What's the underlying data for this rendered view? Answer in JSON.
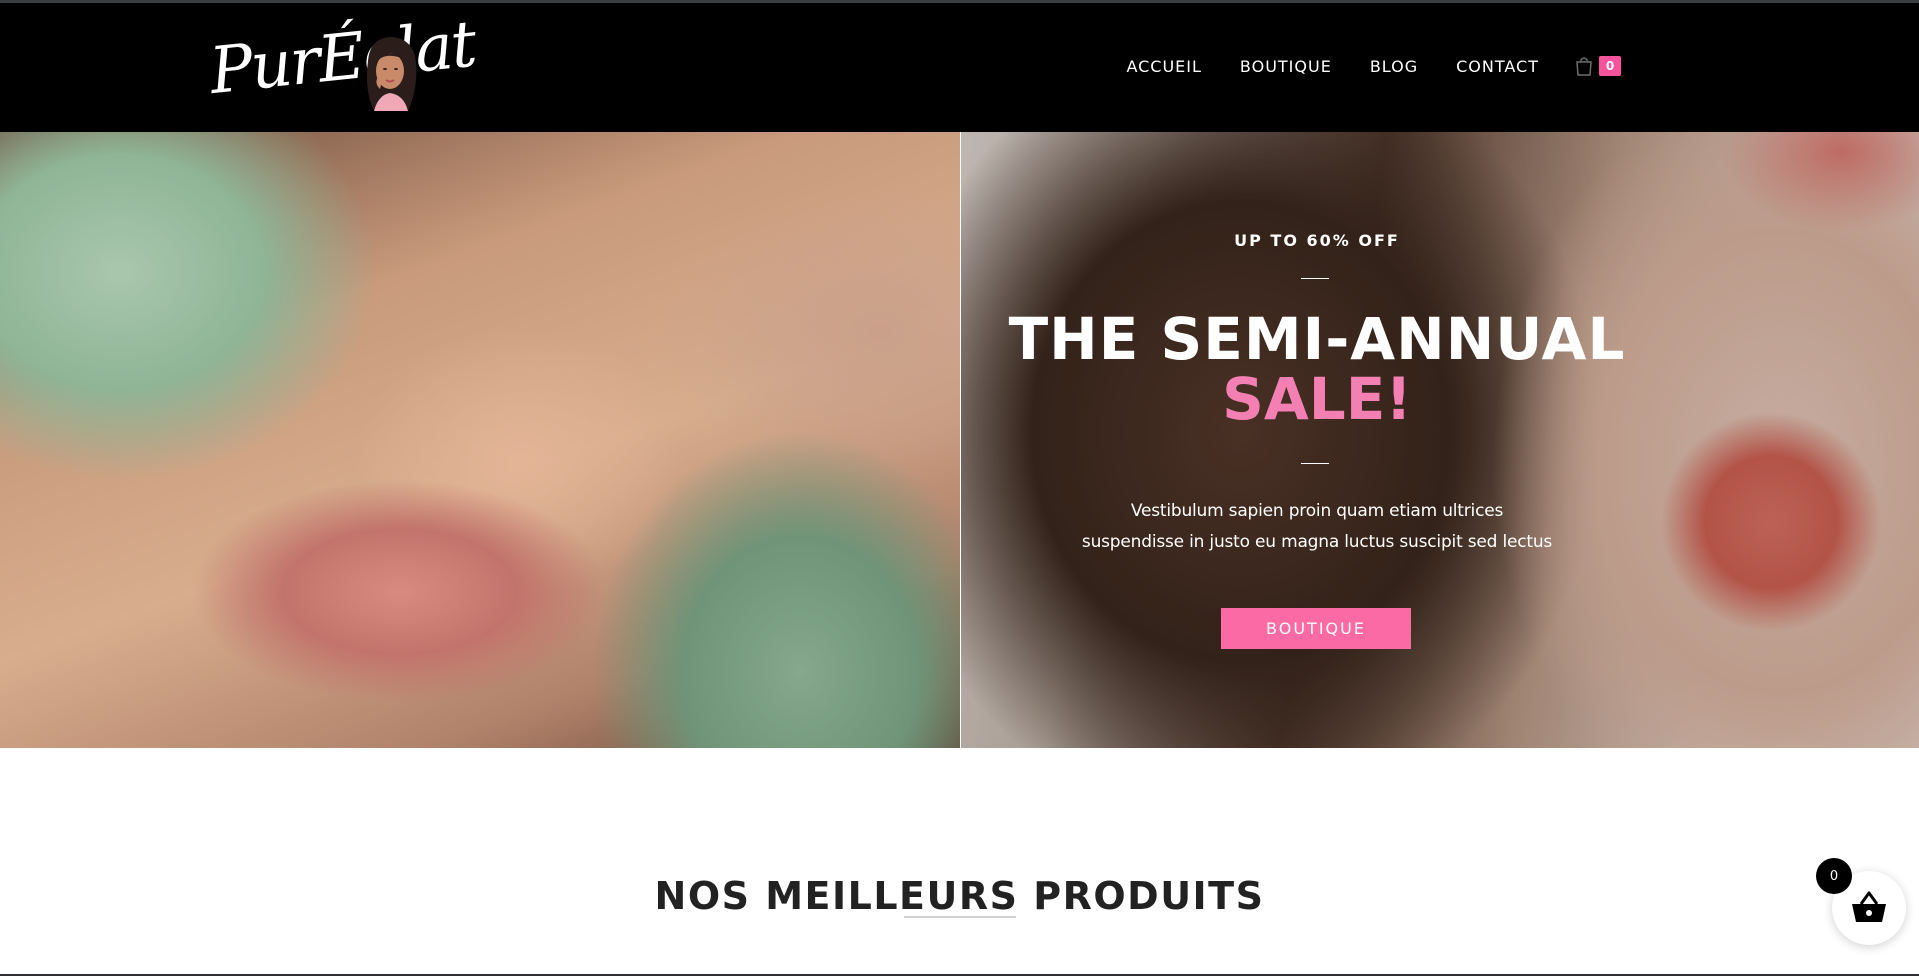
{
  "brand": {
    "logo_text": "PurÉclat"
  },
  "nav": {
    "items": [
      {
        "label": "ACCUEIL"
      },
      {
        "label": "BOUTIQUE"
      },
      {
        "label": "BLOG"
      },
      {
        "label": "CONTACT"
      }
    ],
    "cart_count": "0"
  },
  "hero": {
    "eyebrow": "UP TO 60% OFF",
    "title_line1": "THE SEMI-ANNUAL",
    "title_line2": "SALE!",
    "description_line1": "Vestibulum sapien proin quam etiam ultrices",
    "description_line2": "suspendisse in justo eu magna luctus suscipit sed lectus",
    "button_label": "BOUTIQUE"
  },
  "section": {
    "title": "NOS MEILLEURS PRODUITS"
  },
  "floating_cart": {
    "count": "0"
  },
  "colors": {
    "header_bg": "#000000",
    "accent_pink": "#fb6aa5",
    "title_pink": "#f47fb2",
    "badge_pink": "#f7539c"
  },
  "icons": {
    "header_cart": "shopping-bag-icon",
    "floating_cart": "basket-icon"
  }
}
